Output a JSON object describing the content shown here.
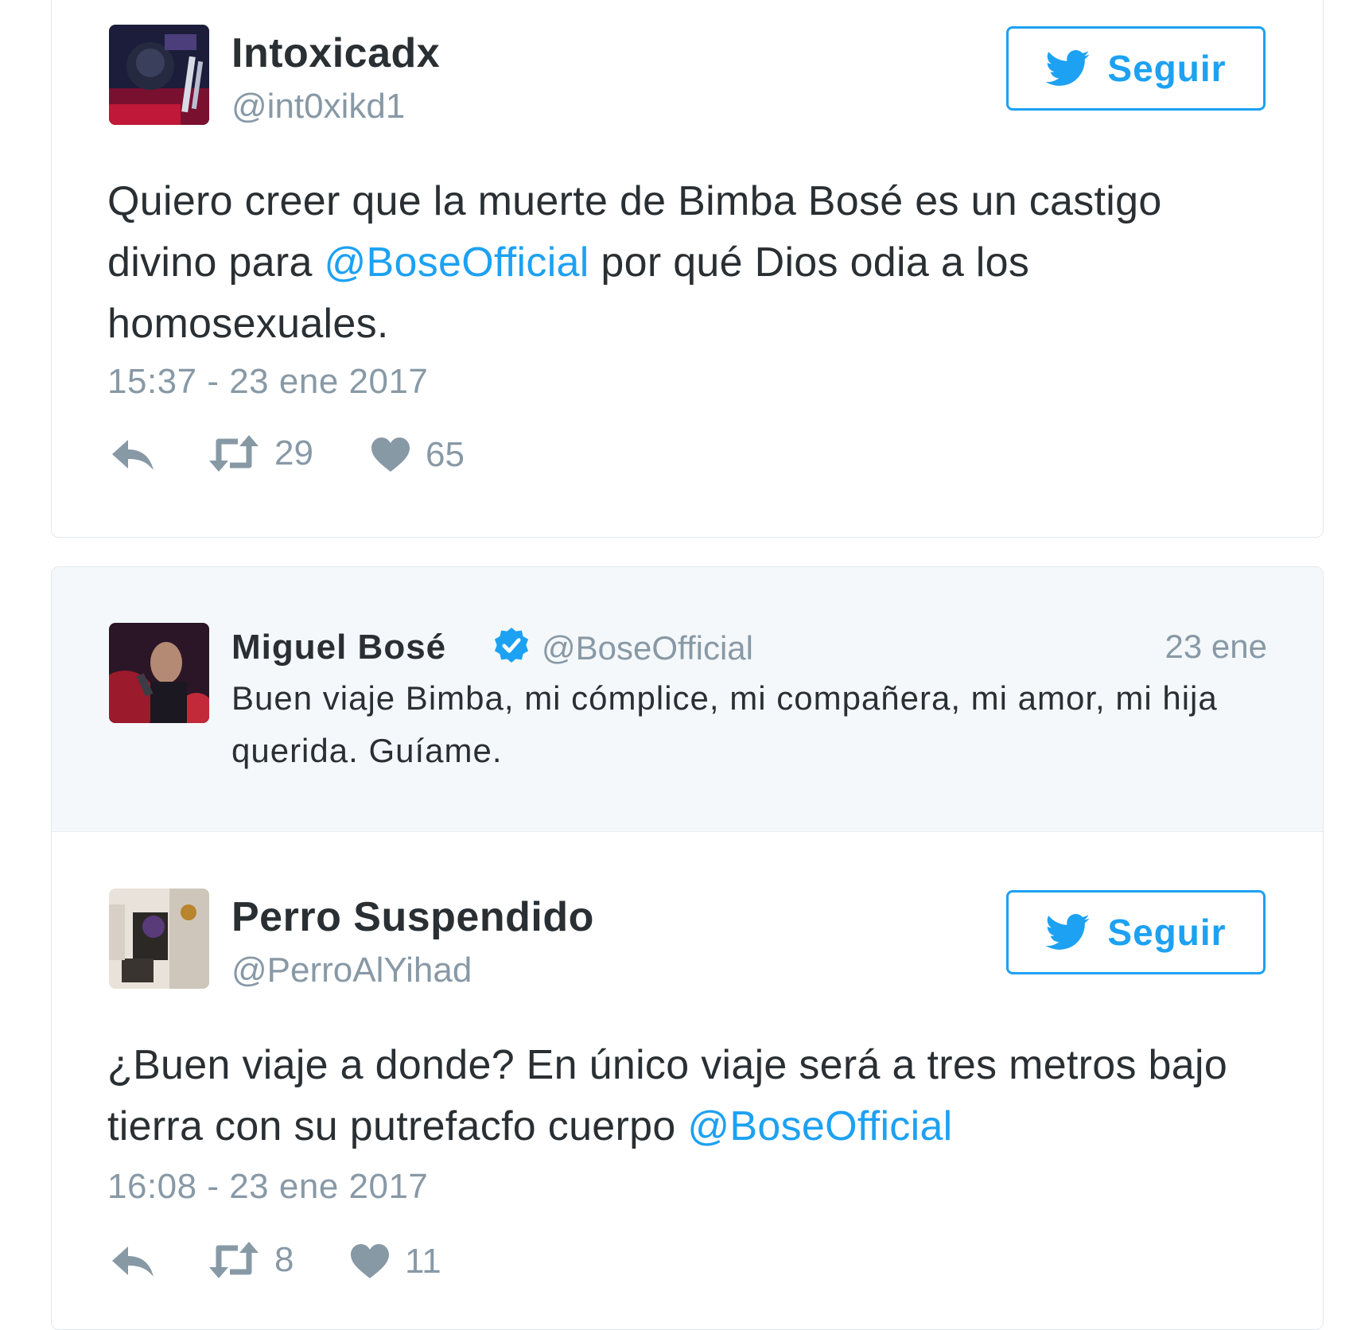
{
  "colors": {
    "accent": "#1da1f2",
    "secondary_text": "#8899a6",
    "primary_text": "#292f33",
    "quoted_bg": "#f5f8fa"
  },
  "tweet1": {
    "display_name": "Intoxicadx",
    "handle": "@int0xikd1",
    "follow_label": "Seguir",
    "text_part1": "Quiero creer que la muerte de Bimba Bosé es un castigo divino para ",
    "mention": "@BoseOfficial",
    "text_part2": " por qué Dios odia a los homosexuales.",
    "timestamp": "15:37 - 23 ene 2017",
    "retweets": "29",
    "likes": "65",
    "icons": {
      "reply": "reply-icon",
      "retweet": "retweet-icon",
      "like": "heart-icon",
      "follow": "twitter-bird-icon"
    }
  },
  "quoted": {
    "display_name": "Miguel Bosé",
    "handle": "@BoseOfficial",
    "date": "23 ene",
    "text": "Buen viaje Bimba, mi cómplice, mi compañera, mi amor, mi hija querida. Guíame.",
    "verified_icon": "verified-badge-icon"
  },
  "tweet2": {
    "display_name": "Perro Suspendido",
    "handle": "@PerroAlYihad",
    "follow_label": "Seguir",
    "text_part1": "¿Buen viaje a donde? En único viaje será a tres metros bajo tierra con su putrefacfo cuerpo ",
    "mention": "@BoseOfficial",
    "timestamp": "16:08 - 23 ene 2017",
    "retweets": "8",
    "likes": "11"
  }
}
